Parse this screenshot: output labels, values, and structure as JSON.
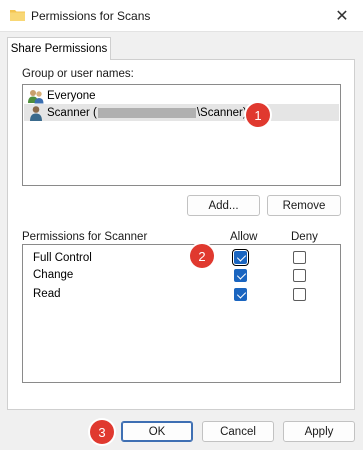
{
  "window": {
    "title": "Permissions for Scans",
    "folder_icon": "folder-icon",
    "close_glyph": "✕"
  },
  "tab": {
    "label": "Share Permissions"
  },
  "users": {
    "heading": "Group or user names:",
    "items": [
      {
        "name": "Everyone",
        "icon": "group-icon",
        "selected": false
      },
      {
        "prefix": "Scanner (",
        "suffix": "\\Scanner)",
        "icon": "user-icon",
        "selected": true
      }
    ],
    "add_label": "Add...",
    "remove_label": "Remove"
  },
  "permissions": {
    "heading": "Permissions for Scanner",
    "allow_label": "Allow",
    "deny_label": "Deny",
    "rows": [
      {
        "label": "Full Control",
        "allow": true,
        "deny": false
      },
      {
        "label": "Change",
        "allow": true,
        "deny": false
      },
      {
        "label": "Read",
        "allow": true,
        "deny": false
      }
    ]
  },
  "buttons": {
    "ok": "OK",
    "cancel": "Cancel",
    "apply": "Apply"
  },
  "markers": [
    "1",
    "2",
    "3"
  ],
  "colors": {
    "accent": "#1a65c0",
    "marker": "#e0392f"
  }
}
